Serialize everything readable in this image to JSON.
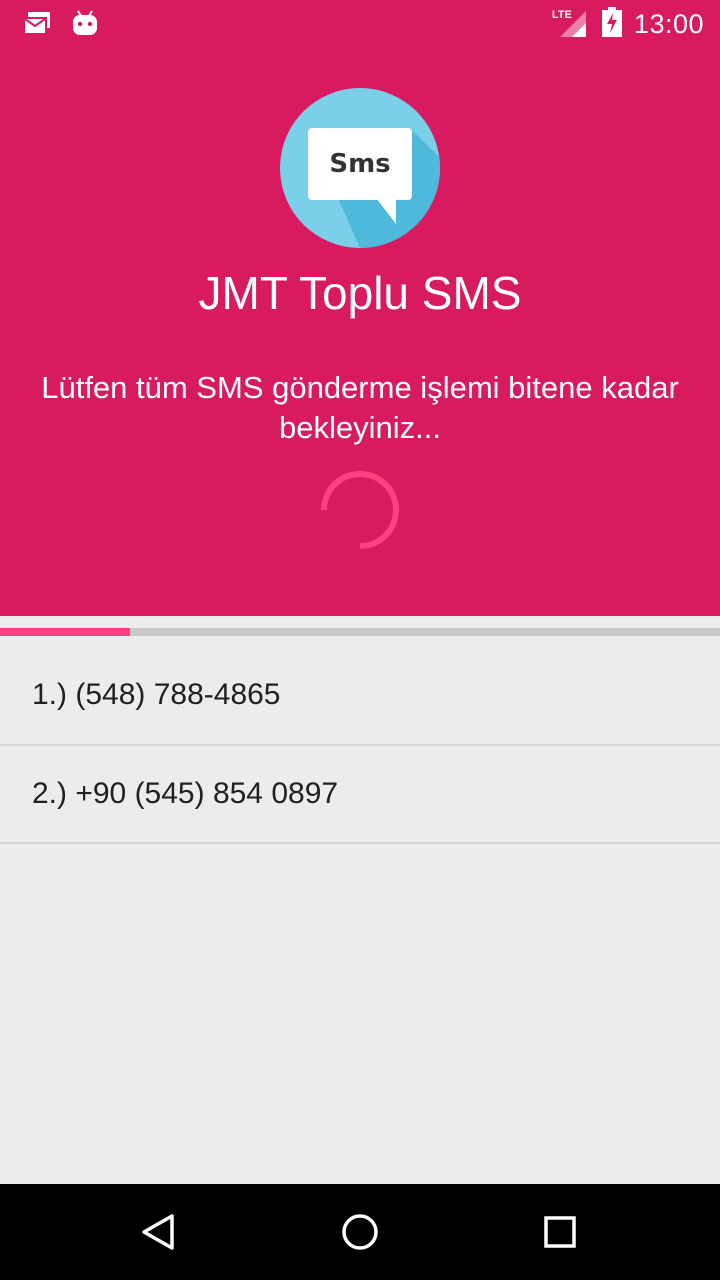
{
  "status_bar": {
    "network": "LTE",
    "time": "13:00",
    "icons": [
      "mail-icon",
      "android-icon",
      "lte-icon",
      "signal-icon",
      "battery-charging-icon"
    ]
  },
  "app": {
    "logo_text": "Sms",
    "title": "JMT Toplu SMS",
    "message": "Lütfen tüm SMS gönderme işlemi bitene kadar bekleyiniz..."
  },
  "progress": {
    "fraction": 0.18
  },
  "recipients": [
    {
      "label": "1.) (548) 788-4865"
    },
    {
      "label": "2.) +90 (545) 854 0897"
    }
  ],
  "nav": {
    "icons": [
      "back-icon",
      "home-icon",
      "recents-icon"
    ]
  },
  "colors": {
    "primary": "#d81b60",
    "accent": "#ff4081",
    "logo_circle": "#4fc3f7",
    "background": "#ececec"
  }
}
